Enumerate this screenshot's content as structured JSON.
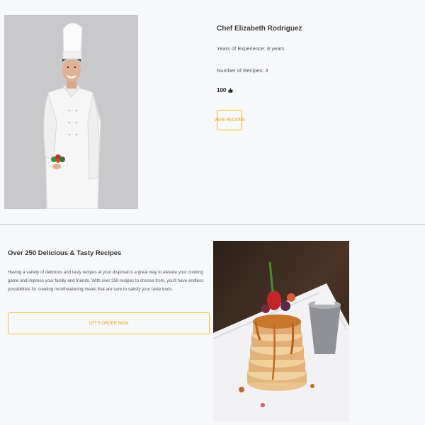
{
  "chef": {
    "name": "Chef Elizabeth Rodriguez",
    "experience": "Years of Experience: 8 years",
    "recipes": "Number of Recipes: 3",
    "likes": "100",
    "view_button": "VIEW RECIPES",
    "photo_icon": "chef-photo",
    "like_icon": "thumbs-up-icon"
  },
  "recipes_section": {
    "title": "Over 250 Delicious & Tasty Recipes",
    "description": "Having a variety of delicious and tasty recipes at your disposal is a great way to elevate your cooking game and impress your family and friends. With over 250 recipes to choose from, you'll have endless possibilities for creating mouthwatering meals that are sure to satisfy your taste buds.",
    "order_button": "LET'S ORDER NOW",
    "photo_icon": "pancake-stack-photo"
  },
  "colors": {
    "accent": "#f2b619",
    "accent_text": "#e3a40c",
    "background": "#f7f8fa",
    "divider": "#dcdcdc"
  }
}
